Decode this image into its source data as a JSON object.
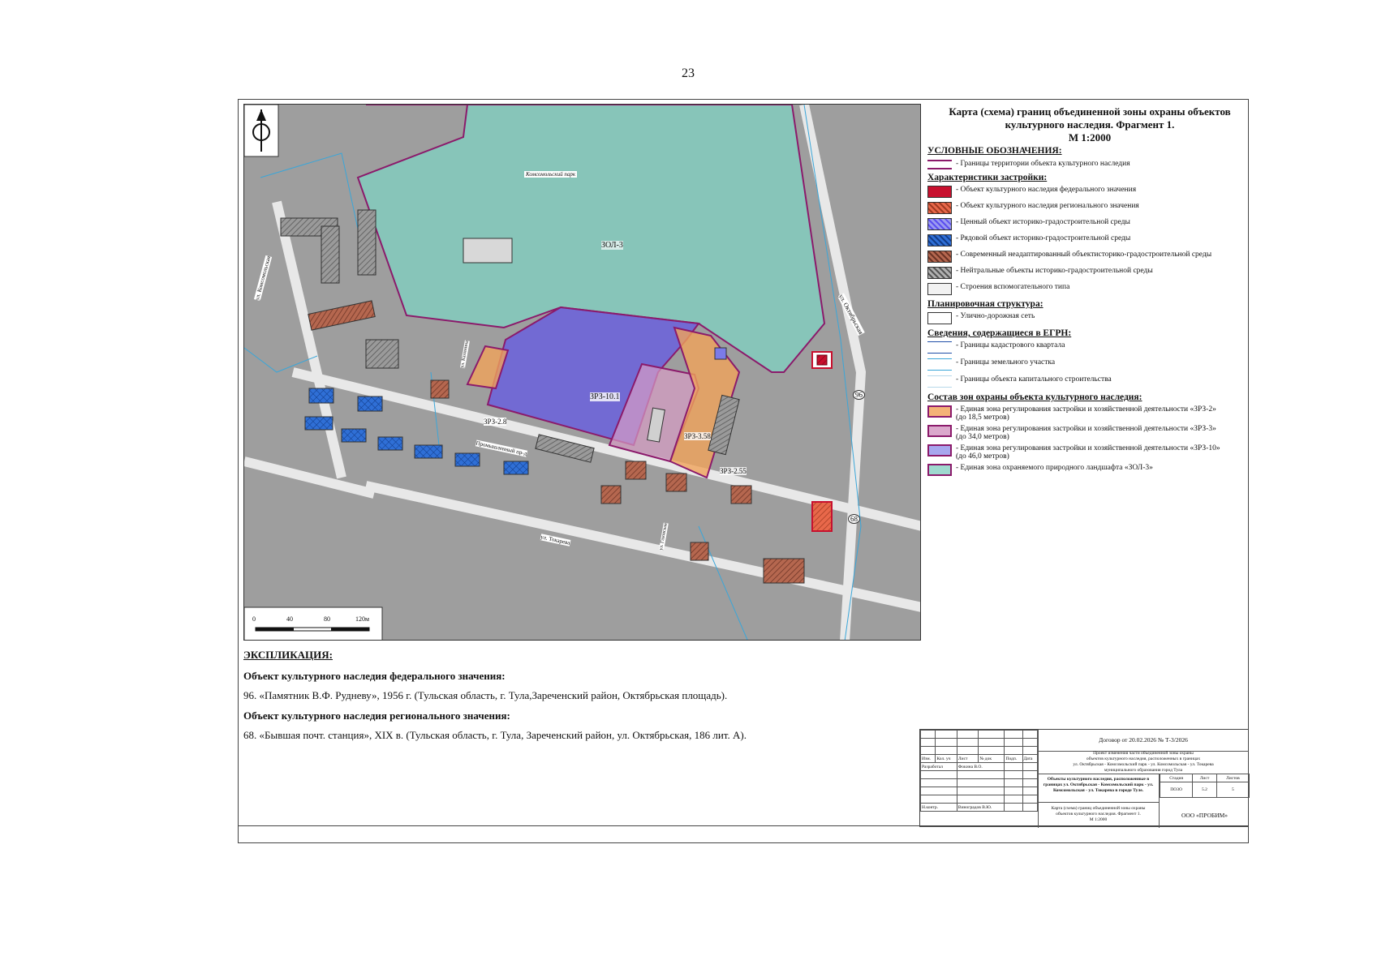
{
  "page_number": "23",
  "legend": {
    "title_line1": "Карта (схема) границ объединенной зоны охраны объектов",
    "title_line2": "культурного наследия. Фрагмент 1.",
    "title_line3": "М 1:2000",
    "section_conventional": "УСЛОВНЫЕ ОБОЗНАЧЕНИЯ:",
    "item_heritage_border": "- Границы территории объекта культурного наследия",
    "section_building": "Характеристики застройки:",
    "building_items": [
      {
        "label": "- Объект культурного наследия федерального значения",
        "color": "#c8102e"
      },
      {
        "label": "- Объект культурного наследия регионального значения",
        "color": "#e8684a"
      },
      {
        "label": "- Ценный объект историко-градостроительной среды",
        "color": "#7b7be8"
      },
      {
        "label": "- Рядовой объект историко-градостроительной среды",
        "color": "#2f6fd6"
      },
      {
        "label": "- Современный неадаптированный объектисторико-градостроительной среды",
        "color": "#b5674f"
      },
      {
        "label": "- Нейтральные объекты историко-градостроительной среды",
        "color": "#8a8a8a"
      },
      {
        "label": "- Строения вспомогательного типа",
        "color": "#f2f2f2"
      }
    ],
    "section_planning": "Планировочная структура:",
    "item_roads": "- Улично-дорожная сеть",
    "section_egrn": "Сведения, содержащиеся в ЕГРН:",
    "egrn_items": [
      {
        "label": "- Границы кадастрового квартала",
        "color": "#1f4fa8"
      },
      {
        "label": "- Границы земельного участка",
        "color": "#3aa6d9"
      },
      {
        "label": "- Границы объекта капитального строительства",
        "color": "#b7d8ea"
      }
    ],
    "section_zones": "Состав зон охраны объекта культурного наследия:",
    "zone_items": [
      {
        "label": "- Единая зона регулирования застройки и хозяйственной деятельности «ЗРЗ-2»",
        "sub": "(до 18,5 метров)",
        "color": "#f4b377"
      },
      {
        "label": "- Единая зона регулирования застройки и хозяйственной деятельности «ЗРЗ-3»",
        "sub": "(до 34,0 метров)",
        "color": "#dba8cc"
      },
      {
        "label": "- Единая зона регулирования застройки и хозяйственной деятельности «ЗРЗ-10»",
        "sub": "(до 46,0 метров)",
        "color": "#a7a7ee"
      },
      {
        "label": "- Единая зона охраняемого природного ландшафта «ЗОЛ-3»",
        "sub": "",
        "color": "#9fd9cf"
      }
    ]
  },
  "map": {
    "labels": {
      "park": "Комсомольский парк",
      "zol3": "ЗОЛ-3",
      "zrz10": "ЗРЗ-10.1",
      "zrz28": "ЗРЗ-2.8",
      "zrz358": "ЗРЗ-3.58",
      "zrz255": "ЗРЗ-2.55",
      "obj96": "96",
      "obj68": "68",
      "street_oct": "ул. Октябрьская",
      "street_prom": "Промышленный пр-д",
      "street_tok": "ул. Токарева",
      "street_kom": "ул. Комсомольская",
      "street_kalinin": "ул. Калинина",
      "street_gazov": "ул. Газовская"
    },
    "scale": {
      "t0": "0",
      "t40": "40",
      "t80": "80",
      "t120": "120м"
    }
  },
  "explication": {
    "title": "ЭКСПЛИКАЦИЯ:",
    "federal_header": "Объект культурного наследия федерального значения:",
    "federal_item": "96. «Памятник В.Ф. Рудневу», 1956 г. (Тульская область, г. Тула,Зареченский район, Октябрьская площадь).",
    "regional_header": "Объект культурного наследия регионального значения:",
    "regional_item": "68. «Бывшая почт. станция», XIX в. (Тульская область, г. Тула, Зареченский район, ул. Октябрьская, 186 лит. А)."
  },
  "stamp": {
    "contract": "Договор от 20.02.2026 № Т-3/2026",
    "project_l1": "Проект изменения части объединенной зоны охраны",
    "project_l2": "объектов культурного наследия, расположенных в границах",
    "project_l3": "ул. Октябрьская - Комсомольский парк - ул. Комсомольская - ул. Токарева",
    "project_l4": "муниципального образования город Тула",
    "col_izm": "Изм.",
    "col_kol": "Кол. уч",
    "col_list": "Лист",
    "col_doc": "№ док",
    "col_podp": "Подп.",
    "col_date": "Дата",
    "developer_role": "Разработал",
    "developer_name": "Фокина В.О.",
    "control_role": "Н.контр.",
    "control_name": "Виноградов В.Ю.",
    "object_l1": "Объекты культурного наследия, расположенные в",
    "object_l2": "границах ул. Октябрьская - Комсомольский парк - ул.",
    "object_l3": "Комсомольская - ул. Токарева в городе Туле.",
    "stage_h": "Стадия",
    "sheet_h": "Лист",
    "sheets_h": "Листов",
    "stage": "ПОЗО",
    "sheet": "5.2",
    "sheets": "5",
    "drawing_l1": "Карта (схема) границ объединенной зоны охраны",
    "drawing_l2": "объектов культурного наследия. Фрагмент 1.",
    "drawing_l3": "М 1:2000",
    "company": "ООО «ПРОБИМ»"
  }
}
